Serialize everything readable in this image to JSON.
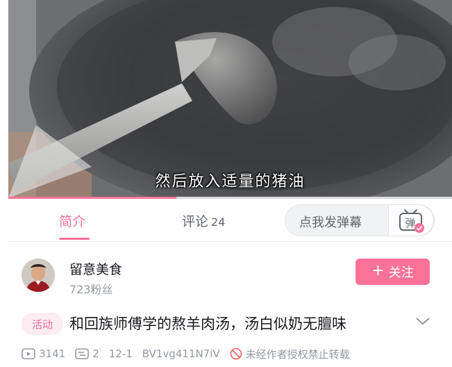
{
  "player": {
    "subtitle": "然后放入适量的猪油",
    "progress_fraction": 0.378
  },
  "tabs": {
    "intro_label": "简介",
    "comments_label": "评论",
    "comments_count": "24",
    "danmaku_placeholder": "点我发弹幕",
    "danmaku_icon_text": "弹",
    "active": "简介"
  },
  "uploader": {
    "name": "留意美食",
    "fans": "723粉丝",
    "follow_label": "关注"
  },
  "video": {
    "tag": "活动",
    "title": "和回族师傅学的熬羊肉汤，汤白似奶无膻味",
    "plays": "3141",
    "danmaku_count": "2",
    "date": "12-1",
    "bvid": "BV1vg411N7iV",
    "notice": "未经作者授权禁止转载"
  },
  "colors": {
    "accent": "#fb7299",
    "text_secondary": "#9499a0"
  }
}
